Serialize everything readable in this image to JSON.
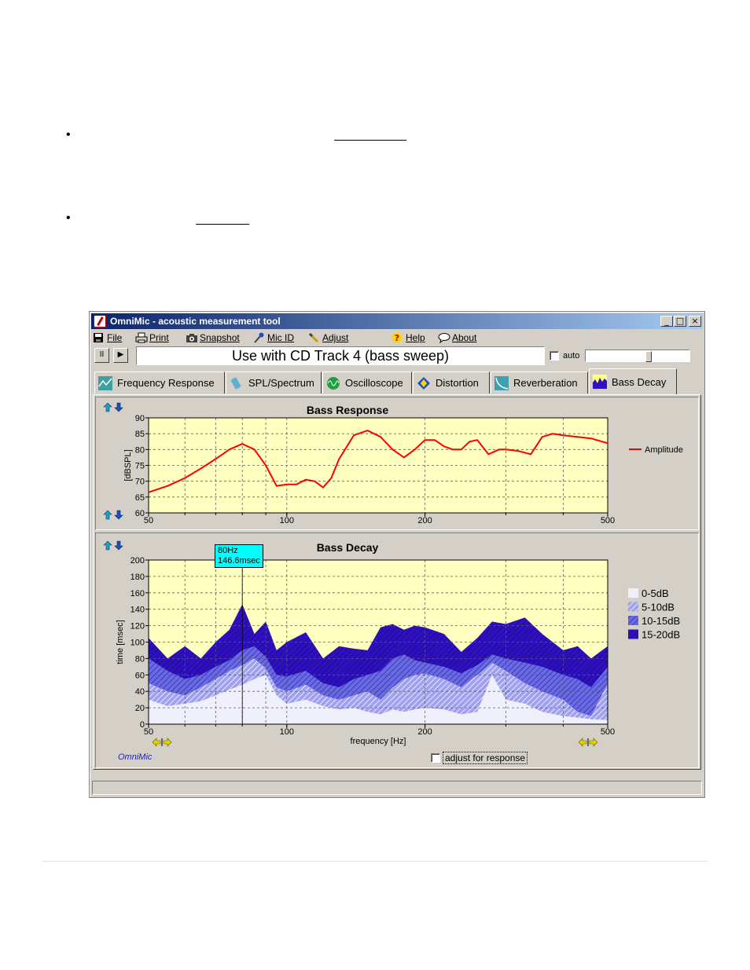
{
  "window": {
    "title": "OmniMic - acoustic measurement tool",
    "minimize": "_",
    "maximize": "□",
    "close": "×"
  },
  "menu": [
    {
      "label": "File",
      "icon": "save-icon"
    },
    {
      "label": "Print",
      "icon": "printer-icon"
    },
    {
      "label": "Snapshot",
      "icon": "camera-icon"
    },
    {
      "label": "Mic ID",
      "icon": "microphone-icon"
    },
    {
      "label": "Adjust",
      "icon": "wrench-icon"
    },
    {
      "label": "Help",
      "icon": "help-icon"
    },
    {
      "label": "About",
      "icon": "speech-bubble-icon"
    }
  ],
  "toolbar": {
    "pause_label": "II",
    "play_label": "▶",
    "status_text": "Use with CD Track 4 (bass sweep)",
    "auto_label": "auto",
    "auto_checked": false,
    "slider_level": 0.6
  },
  "tabs": [
    {
      "label": "Frequency Response",
      "icon": "frequency-response-icon",
      "active": false
    },
    {
      "label": "SPL/Spectrum",
      "icon": "spl-meter-icon",
      "active": false
    },
    {
      "label": "Oscilloscope",
      "icon": "oscilloscope-icon",
      "active": false
    },
    {
      "label": "Distortion",
      "icon": "distortion-icon",
      "active": false
    },
    {
      "label": "Reverberation",
      "icon": "reverberation-icon",
      "active": false
    },
    {
      "label": "Bass Decay",
      "icon": "bass-decay-icon",
      "active": true
    }
  ],
  "bottom_controls": {
    "adjust_label": "adjust for response",
    "adjust_checked": false,
    "brand": "OmniMic"
  },
  "tooltip": {
    "line1": "80Hz",
    "line2": "146.6msec"
  },
  "colors": {
    "plot_bg": "#ffffc0",
    "response_line": "#ff0000",
    "band_0_5": "#f0f0fc",
    "band_5_10": "#a0a0f0",
    "band_10_15": "#6a6ae6",
    "band_15_20": "#2e10c0"
  },
  "chart_data": [
    {
      "type": "line",
      "title": "Bass Response",
      "xlabel": "",
      "ylabel": "[dBSPL]",
      "xscale": "log",
      "xlim": [
        50,
        500
      ],
      "ylim": [
        60,
        90
      ],
      "xticks": [
        50,
        100,
        200,
        500
      ],
      "yticks": [
        60,
        65,
        70,
        75,
        80,
        85,
        90
      ],
      "grid": true,
      "legend": "right",
      "series": [
        {
          "name": "Amplitude",
          "x": [
            50,
            55,
            60,
            65,
            70,
            75,
            80,
            85,
            90,
            95,
            100,
            105,
            110,
            115,
            120,
            125,
            130,
            140,
            150,
            160,
            170,
            180,
            190,
            200,
            210,
            220,
            230,
            240,
            250,
            260,
            275,
            290,
            300,
            320,
            340,
            360,
            380,
            400,
            430,
            460,
            500
          ],
          "y": [
            66.5,
            68.5,
            71,
            74,
            77,
            80,
            81.8,
            80,
            75,
            68.5,
            69,
            69,
            70.5,
            70,
            68,
            71,
            77,
            84.5,
            86,
            84,
            80,
            77.5,
            80,
            83,
            83,
            81,
            80,
            80,
            82.5,
            83,
            78.5,
            80,
            80,
            79.5,
            78.5,
            84,
            85,
            84.5,
            84,
            83.5,
            82
          ]
        }
      ]
    },
    {
      "type": "area",
      "title": "Bass Decay",
      "xlabel": "frequency [Hz]",
      "ylabel": "time [msec]",
      "xscale": "log",
      "xlim": [
        50,
        500
      ],
      "ylim": [
        0,
        200
      ],
      "xticks": [
        50,
        100,
        200,
        500
      ],
      "yticks": [
        0,
        20,
        40,
        60,
        80,
        100,
        120,
        140,
        160,
        180,
        200
      ],
      "grid": true,
      "legend": "right",
      "x": [
        50,
        55,
        60,
        65,
        70,
        75,
        80,
        85,
        90,
        95,
        100,
        110,
        120,
        130,
        140,
        150,
        160,
        170,
        180,
        190,
        200,
        220,
        240,
        260,
        280,
        300,
        330,
        360,
        400,
        430,
        460,
        500
      ],
      "series": [
        {
          "name": "0-5dB",
          "values": [
            30,
            22,
            25,
            28,
            35,
            42,
            48,
            55,
            60,
            35,
            25,
            30,
            22,
            18,
            20,
            15,
            12,
            18,
            15,
            18,
            20,
            18,
            12,
            15,
            60,
            30,
            25,
            15,
            10,
            8,
            6,
            5
          ]
        },
        {
          "name": "5-10dB",
          "values": [
            50,
            40,
            35,
            45,
            55,
            65,
            72,
            80,
            68,
            45,
            40,
            48,
            35,
            30,
            35,
            40,
            30,
            45,
            55,
            60,
            62,
            55,
            45,
            60,
            75,
            65,
            50,
            40,
            30,
            15,
            10,
            50
          ]
        },
        {
          "name": "10-15dB",
          "values": [
            80,
            65,
            55,
            60,
            70,
            78,
            90,
            95,
            82,
            60,
            58,
            65,
            50,
            45,
            55,
            60,
            65,
            80,
            85,
            78,
            75,
            70,
            62,
            72,
            85,
            80,
            75,
            70,
            60,
            55,
            45,
            70
          ]
        },
        {
          "name": "15-20dB",
          "values": [
            105,
            80,
            95,
            80,
            100,
            115,
            146,
            110,
            125,
            90,
            100,
            112,
            80,
            95,
            92,
            90,
            118,
            122,
            115,
            120,
            118,
            110,
            88,
            105,
            125,
            122,
            130,
            110,
            90,
            95,
            80,
            95
          ]
        }
      ]
    }
  ]
}
